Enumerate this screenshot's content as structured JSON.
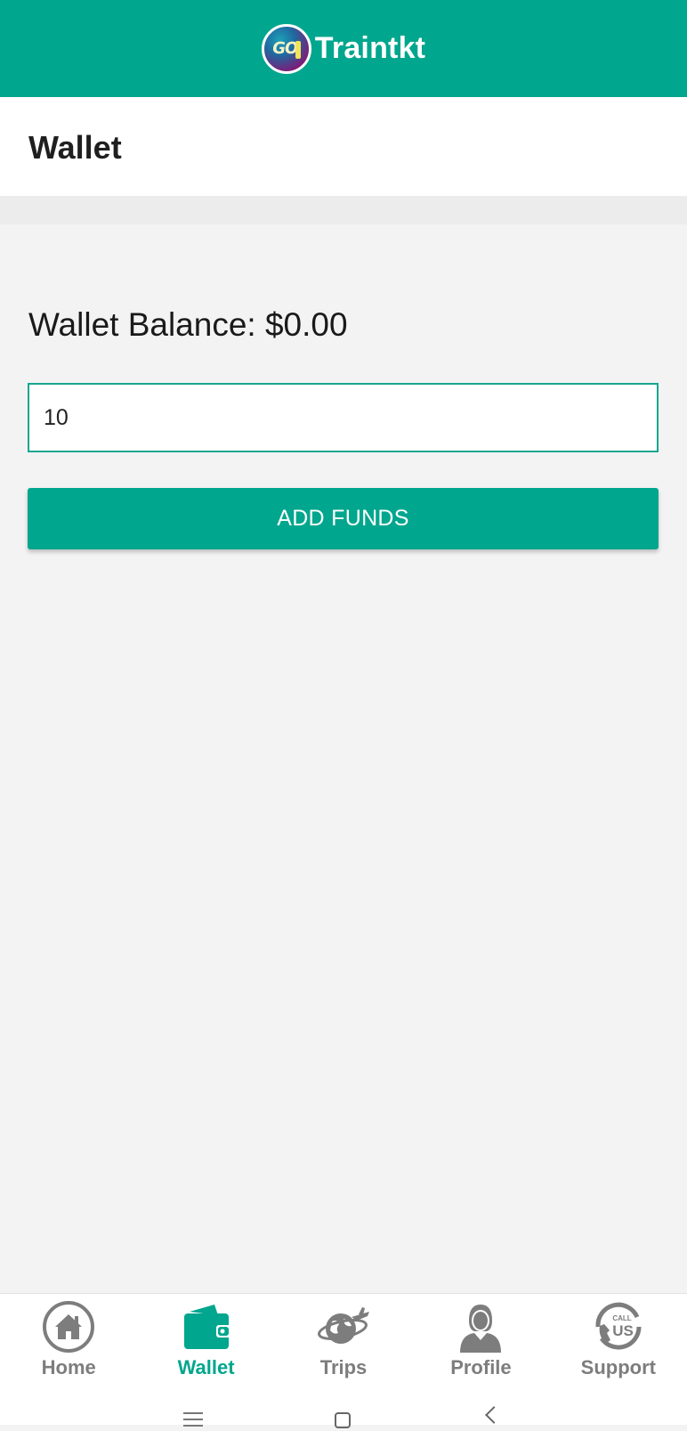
{
  "header": {
    "logo_text": "GO",
    "app_name": "Traintkt",
    "brand_color": "#00a68d"
  },
  "page": {
    "title": "Wallet"
  },
  "wallet": {
    "balance_text": "Wallet Balance: $0.00",
    "amount_value": "10",
    "add_funds_label": "ADD FUNDS"
  },
  "bottom_nav": {
    "active_index": 1,
    "items": [
      {
        "label": "Home",
        "icon": "home-icon"
      },
      {
        "label": "Wallet",
        "icon": "wallet-icon"
      },
      {
        "label": "Trips",
        "icon": "globe-plane-icon"
      },
      {
        "label": "Profile",
        "icon": "person-icon"
      },
      {
        "label": "Support",
        "icon": "call-us-icon"
      }
    ]
  },
  "system_nav": {
    "buttons": [
      "recent-apps",
      "home",
      "back"
    ]
  }
}
